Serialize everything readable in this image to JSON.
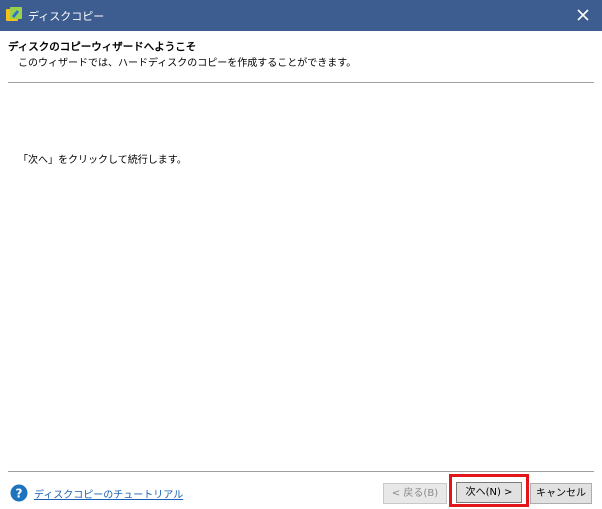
{
  "window": {
    "title": "ディスクコピー",
    "icon": "app-icon",
    "close_icon": "close-icon"
  },
  "header": {
    "title": "ディスクのコピーウィザードへようこそ",
    "subtitle": "このウィザードでは、ハードディスクのコピーを作成することができます。"
  },
  "body": {
    "instruction": "「次へ」をクリックして続行します。"
  },
  "footer": {
    "help_icon": "help-icon",
    "help_link": "ディスクコピーのチュートリアル",
    "back_label": "< 戻る(B)",
    "next_label": "次へ(N) >",
    "cancel_label": "キャンセル"
  },
  "colors": {
    "titlebar": "#3d5c8f",
    "link": "#1a5fb4",
    "highlight": "#e0161b",
    "help_icon": "#1e73be"
  }
}
